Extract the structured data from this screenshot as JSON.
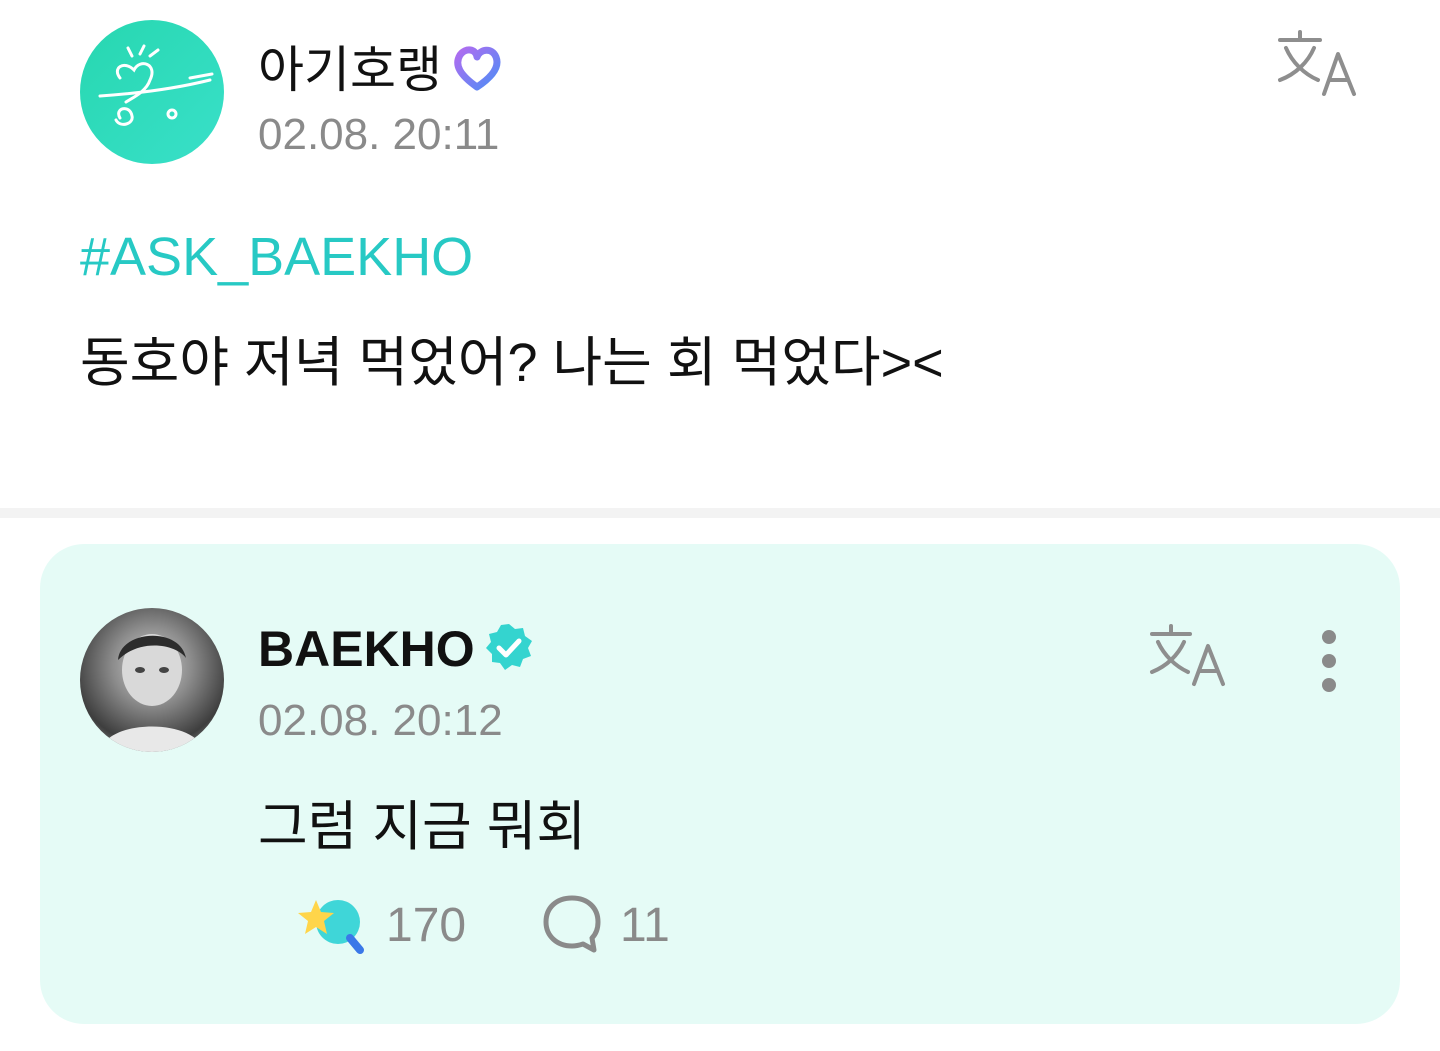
{
  "post": {
    "author": "아기호랭",
    "timestamp": "02.08. 20:11",
    "hashtag": "#ASK_BAEKHO",
    "text": "동호야 저녁 먹었어? 나는 회 먹었다><"
  },
  "reply": {
    "author": "BAEKHO",
    "timestamp": "02.08. 20:12",
    "text": "그럼 지금 뭐회",
    "likes": "170",
    "comments": "11"
  },
  "colors": {
    "accent": "#27c9c4",
    "card_bg": "#e5fbf6",
    "muted": "#8a8a8a"
  },
  "icons": {
    "translate": "translate-icon",
    "more": "more-vertical-icon",
    "like": "star-lightstick-icon",
    "comment": "comment-bubble-icon",
    "fan_badge": "heart-badge-icon",
    "verified": "verified-badge-icon"
  }
}
